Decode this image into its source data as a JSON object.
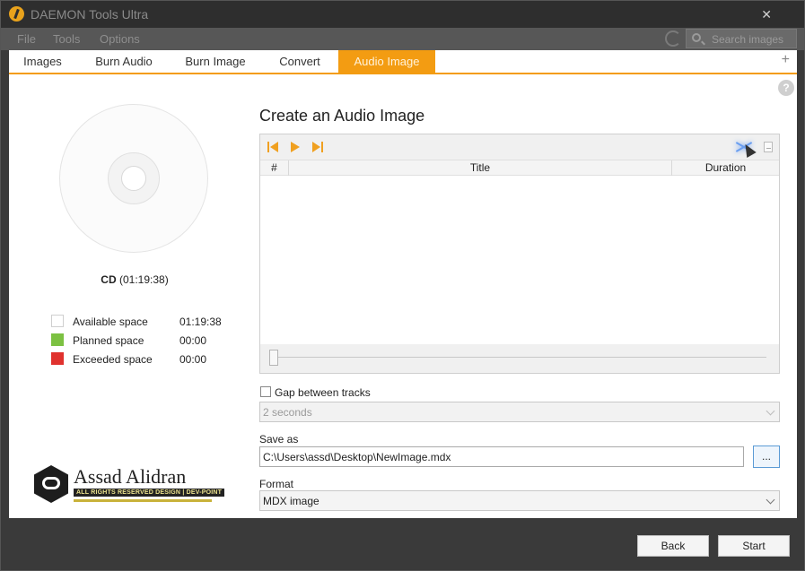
{
  "app": {
    "title": "DAEMON Tools Ultra",
    "close_glyph": "✕"
  },
  "menu": {
    "items": [
      "File",
      "Tools",
      "Options"
    ],
    "search_placeholder": "Search images"
  },
  "tabs": {
    "items": [
      "Images",
      "Burn Audio",
      "Burn Image",
      "Convert",
      "Audio Image"
    ],
    "active": "Audio Image",
    "add_glyph": "+"
  },
  "left": {
    "disc_type": "CD",
    "disc_capacity": "(01:19:38)",
    "legend": [
      {
        "label": "Available space",
        "value": "01:19:38",
        "color": "#ffffff"
      },
      {
        "label": "Planned space",
        "value": "00:00",
        "color": "#7cc142"
      },
      {
        "label": "Exceeded space",
        "value": "00:00",
        "color": "#e0322e"
      }
    ],
    "watermark": {
      "name": "Assad Alidran",
      "tagline": "ALL RIGHTS RESERVED DESIGN | DEV-POINT"
    }
  },
  "main": {
    "help_glyph": "?",
    "title": "Create an Audio Image",
    "columns": {
      "number": "#",
      "title": "Title",
      "duration": "Duration"
    },
    "gap_label": "Gap between tracks",
    "gap_checked": false,
    "gap_value": "2 seconds",
    "save_as_label": "Save as",
    "save_as_value": "C:\\Users\\assd\\Desktop\\NewImage.mdx",
    "browse_label": "...",
    "format_label": "Format",
    "format_value": "MDX image"
  },
  "footer": {
    "back_label": "Back",
    "start_label": "Start"
  },
  "colors": {
    "accent": "#f39c12",
    "titlebar": "#2e2e2e",
    "menubar": "#575757"
  }
}
